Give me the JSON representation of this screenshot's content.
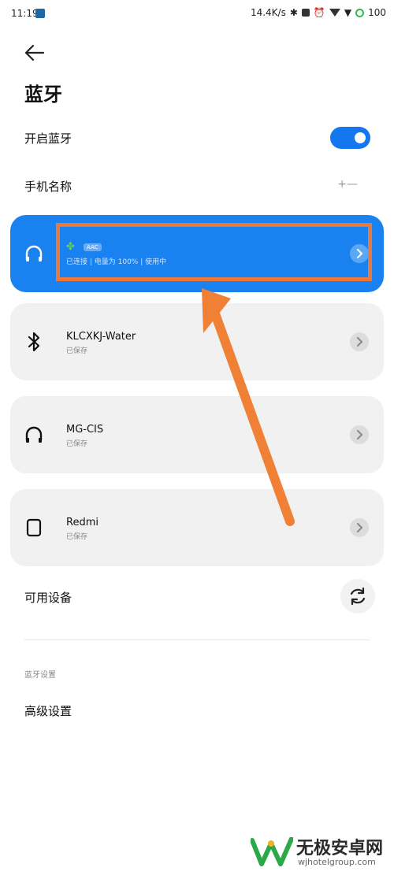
{
  "status_bar": {
    "time": "11:19",
    "speed": "14.4K/s",
    "battery": "100"
  },
  "page": {
    "title": "蓝牙"
  },
  "settings": {
    "enable_label": "开启蓝牙",
    "enable_on": true,
    "phone_name_label": "手机名称",
    "phone_name_value": "+—"
  },
  "devices": [
    {
      "name": "",
      "codec": "AAC",
      "status": "已连接 | 电量为 100% | 使用中",
      "icon": "headphones-icon",
      "active": true
    },
    {
      "name": "KLCXKJ-Water",
      "status": "已保存",
      "icon": "bluetooth-icon"
    },
    {
      "name": "MG-CIS",
      "status": "已保存",
      "icon": "headphones-icon"
    },
    {
      "name": "Redmi",
      "status": "已保存",
      "icon": "watch-icon"
    }
  ],
  "available": {
    "label": "可用设备"
  },
  "bt_settings": {
    "section_header": "蓝牙设置",
    "advanced_label": "高级设置"
  },
  "watermark": {
    "title": "无极安卓网",
    "url": "wjhotelgroup.com"
  },
  "colors": {
    "accent": "#1a82f0",
    "card_bg": "#f1f1f1",
    "highlight": "#e8793a",
    "arrow": "#f08035"
  }
}
